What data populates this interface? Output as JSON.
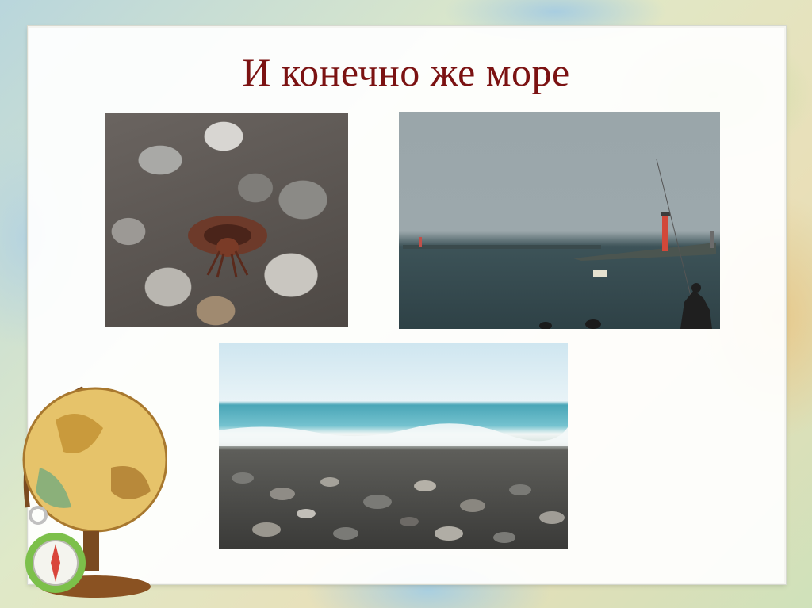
{
  "slide": {
    "title": "И конечно же море"
  },
  "images": [
    {
      "name": "hermit-crab-on-pebbles"
    },
    {
      "name": "harbor-with-lighthouse"
    },
    {
      "name": "pebble-beach-with-waves"
    }
  ],
  "colors": {
    "title": "#7b1212",
    "frame": "#ffffff"
  }
}
